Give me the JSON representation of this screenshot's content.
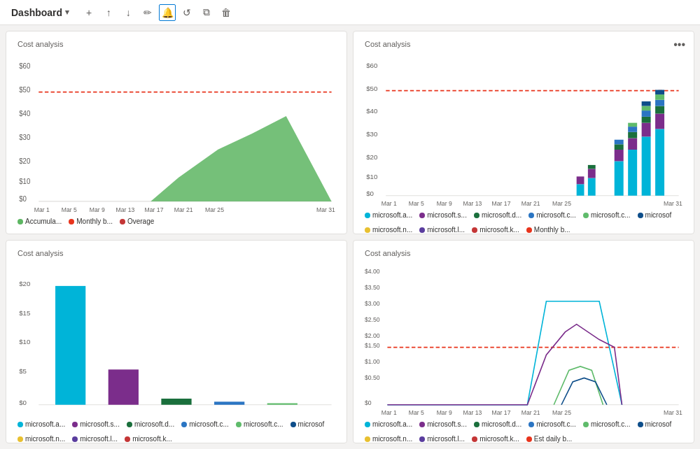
{
  "header": {
    "title": "Dashboard",
    "chevron": "▾",
    "icons": [
      {
        "name": "add-icon",
        "symbol": "+",
        "active": false
      },
      {
        "name": "upload-icon",
        "symbol": "↑",
        "active": false
      },
      {
        "name": "download-icon",
        "symbol": "↓",
        "active": false
      },
      {
        "name": "edit-icon",
        "symbol": "✏",
        "active": false
      },
      {
        "name": "bell-icon",
        "symbol": "🔔",
        "active": true
      },
      {
        "name": "refresh-icon",
        "symbol": "↺",
        "active": false
      },
      {
        "name": "copy-icon",
        "symbol": "⧉",
        "active": false
      },
      {
        "name": "delete-icon",
        "symbol": "🗑",
        "active": false
      }
    ]
  },
  "cards": [
    {
      "id": "card-top-left",
      "title": "Cost analysis",
      "hasMenu": false,
      "type": "area",
      "legend": [
        {
          "label": "Accumula...",
          "color": "#5db662"
        },
        {
          "label": "Monthly b...",
          "color": "#e8341c"
        },
        {
          "label": "Overage",
          "color": "#c43636"
        }
      ]
    },
    {
      "id": "card-top-right",
      "title": "Cost analysis",
      "hasMenu": true,
      "type": "stacked-bar",
      "legend": [
        {
          "label": "microsoft.a...",
          "color": "#00b4d8"
        },
        {
          "label": "microsoft.s...",
          "color": "#7b2d8b"
        },
        {
          "label": "microsoft.d...",
          "color": "#1a6f3c"
        },
        {
          "label": "microsoft.c...",
          "color": "#2b75c3"
        },
        {
          "label": "microsoft.c...",
          "color": "#5fbb6b"
        },
        {
          "label": "microsof",
          "color": "#0e4e8a"
        },
        {
          "label": "microsoft.n...",
          "color": "#e8c030"
        },
        {
          "label": "microsoft.l...",
          "color": "#5a3d9e"
        },
        {
          "label": "microsoft.k...",
          "color": "#c43636"
        },
        {
          "label": "Monthly b...",
          "color": "#e8341c"
        }
      ]
    },
    {
      "id": "card-bottom-left",
      "title": "Cost analysis",
      "hasMenu": false,
      "type": "bar",
      "legend": [
        {
          "label": "microsoft.a...",
          "color": "#00b4d8"
        },
        {
          "label": "microsoft.s...",
          "color": "#7b2d8b"
        },
        {
          "label": "microsoft.d...",
          "color": "#1a6f3c"
        },
        {
          "label": "microsoft.c...",
          "color": "#2b75c3"
        },
        {
          "label": "microsoft.c...",
          "color": "#5fbb6b"
        },
        {
          "label": "microsof",
          "color": "#0e4e8a"
        },
        {
          "label": "microsoft.n...",
          "color": "#e8c030"
        },
        {
          "label": "microsoft.l...",
          "color": "#5a3d9e"
        },
        {
          "label": "microsoft.k...",
          "color": "#c43636"
        }
      ]
    },
    {
      "id": "card-bottom-right",
      "title": "Cost analysis",
      "hasMenu": false,
      "type": "line",
      "legend": [
        {
          "label": "microsoft.a...",
          "color": "#00b4d8"
        },
        {
          "label": "microsoft.s...",
          "color": "#7b2d8b"
        },
        {
          "label": "microsoft.d...",
          "color": "#1a6f3c"
        },
        {
          "label": "microsoft.c...",
          "color": "#2b75c3"
        },
        {
          "label": "microsoft.c...",
          "color": "#5fbb6b"
        },
        {
          "label": "microsof",
          "color": "#0e4e8a"
        },
        {
          "label": "microsoft.n...",
          "color": "#e8c030"
        },
        {
          "label": "microsoft.l...",
          "color": "#5a3d9e"
        },
        {
          "label": "microsoft.k...",
          "color": "#c43636"
        },
        {
          "label": "Est daily b...",
          "color": "#e8341c"
        }
      ]
    }
  ],
  "xLabels": [
    "Mar 1",
    "Mar 5",
    "Mar 9",
    "Mar 13",
    "Mar 17",
    "Mar 21",
    "Mar 25",
    "Mar 31"
  ],
  "monthly_label": "Monthly"
}
